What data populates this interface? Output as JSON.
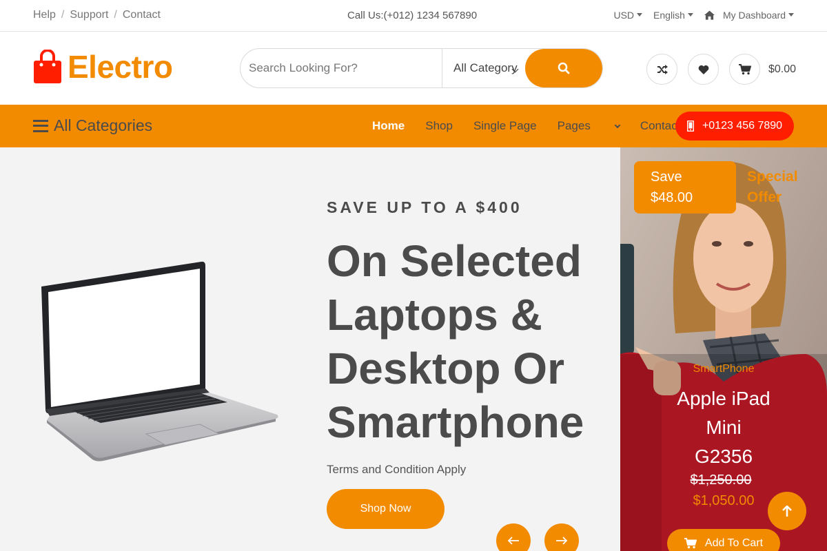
{
  "topbar": {
    "links": [
      "Help",
      "Support",
      "Contact"
    ],
    "call_label": "Call Us:",
    "call_number": "(+012) 1234 567890",
    "currency": "USD",
    "language": "English",
    "dashboard": "My Dashboard"
  },
  "header": {
    "brand": "Electro",
    "search_placeholder": "Search Looking For?",
    "category": "All Category",
    "cart_total": "$0.00"
  },
  "nav": {
    "all_categories": "All Categories",
    "links": [
      "Home",
      "Shop",
      "Single Page",
      "Pages",
      "Contact"
    ],
    "active": "Home",
    "phone": "+0123 456 7890"
  },
  "hero": {
    "eyebrow": "SAVE UP TO A $400",
    "headline": [
      "On Selected",
      "Laptops &",
      "Desktop Or",
      "Smartphone"
    ],
    "terms": "Terms and Condition Apply",
    "cta": "Shop Now"
  },
  "promo": {
    "save_line1": "Save",
    "save_line2": "$48.00",
    "special_line1": "Special",
    "special_line2": "Offer",
    "category": "SmartPhone",
    "name_lines": [
      "Apple iPad",
      "Mini",
      "G2356"
    ],
    "old_price": "$1,250.00",
    "new_price": "$1,050.00",
    "cta": "Add To Cart"
  },
  "colors": {
    "accent": "#f28b00",
    "phone_button": "#ff1e00",
    "text_dark": "#4b4b4b"
  }
}
